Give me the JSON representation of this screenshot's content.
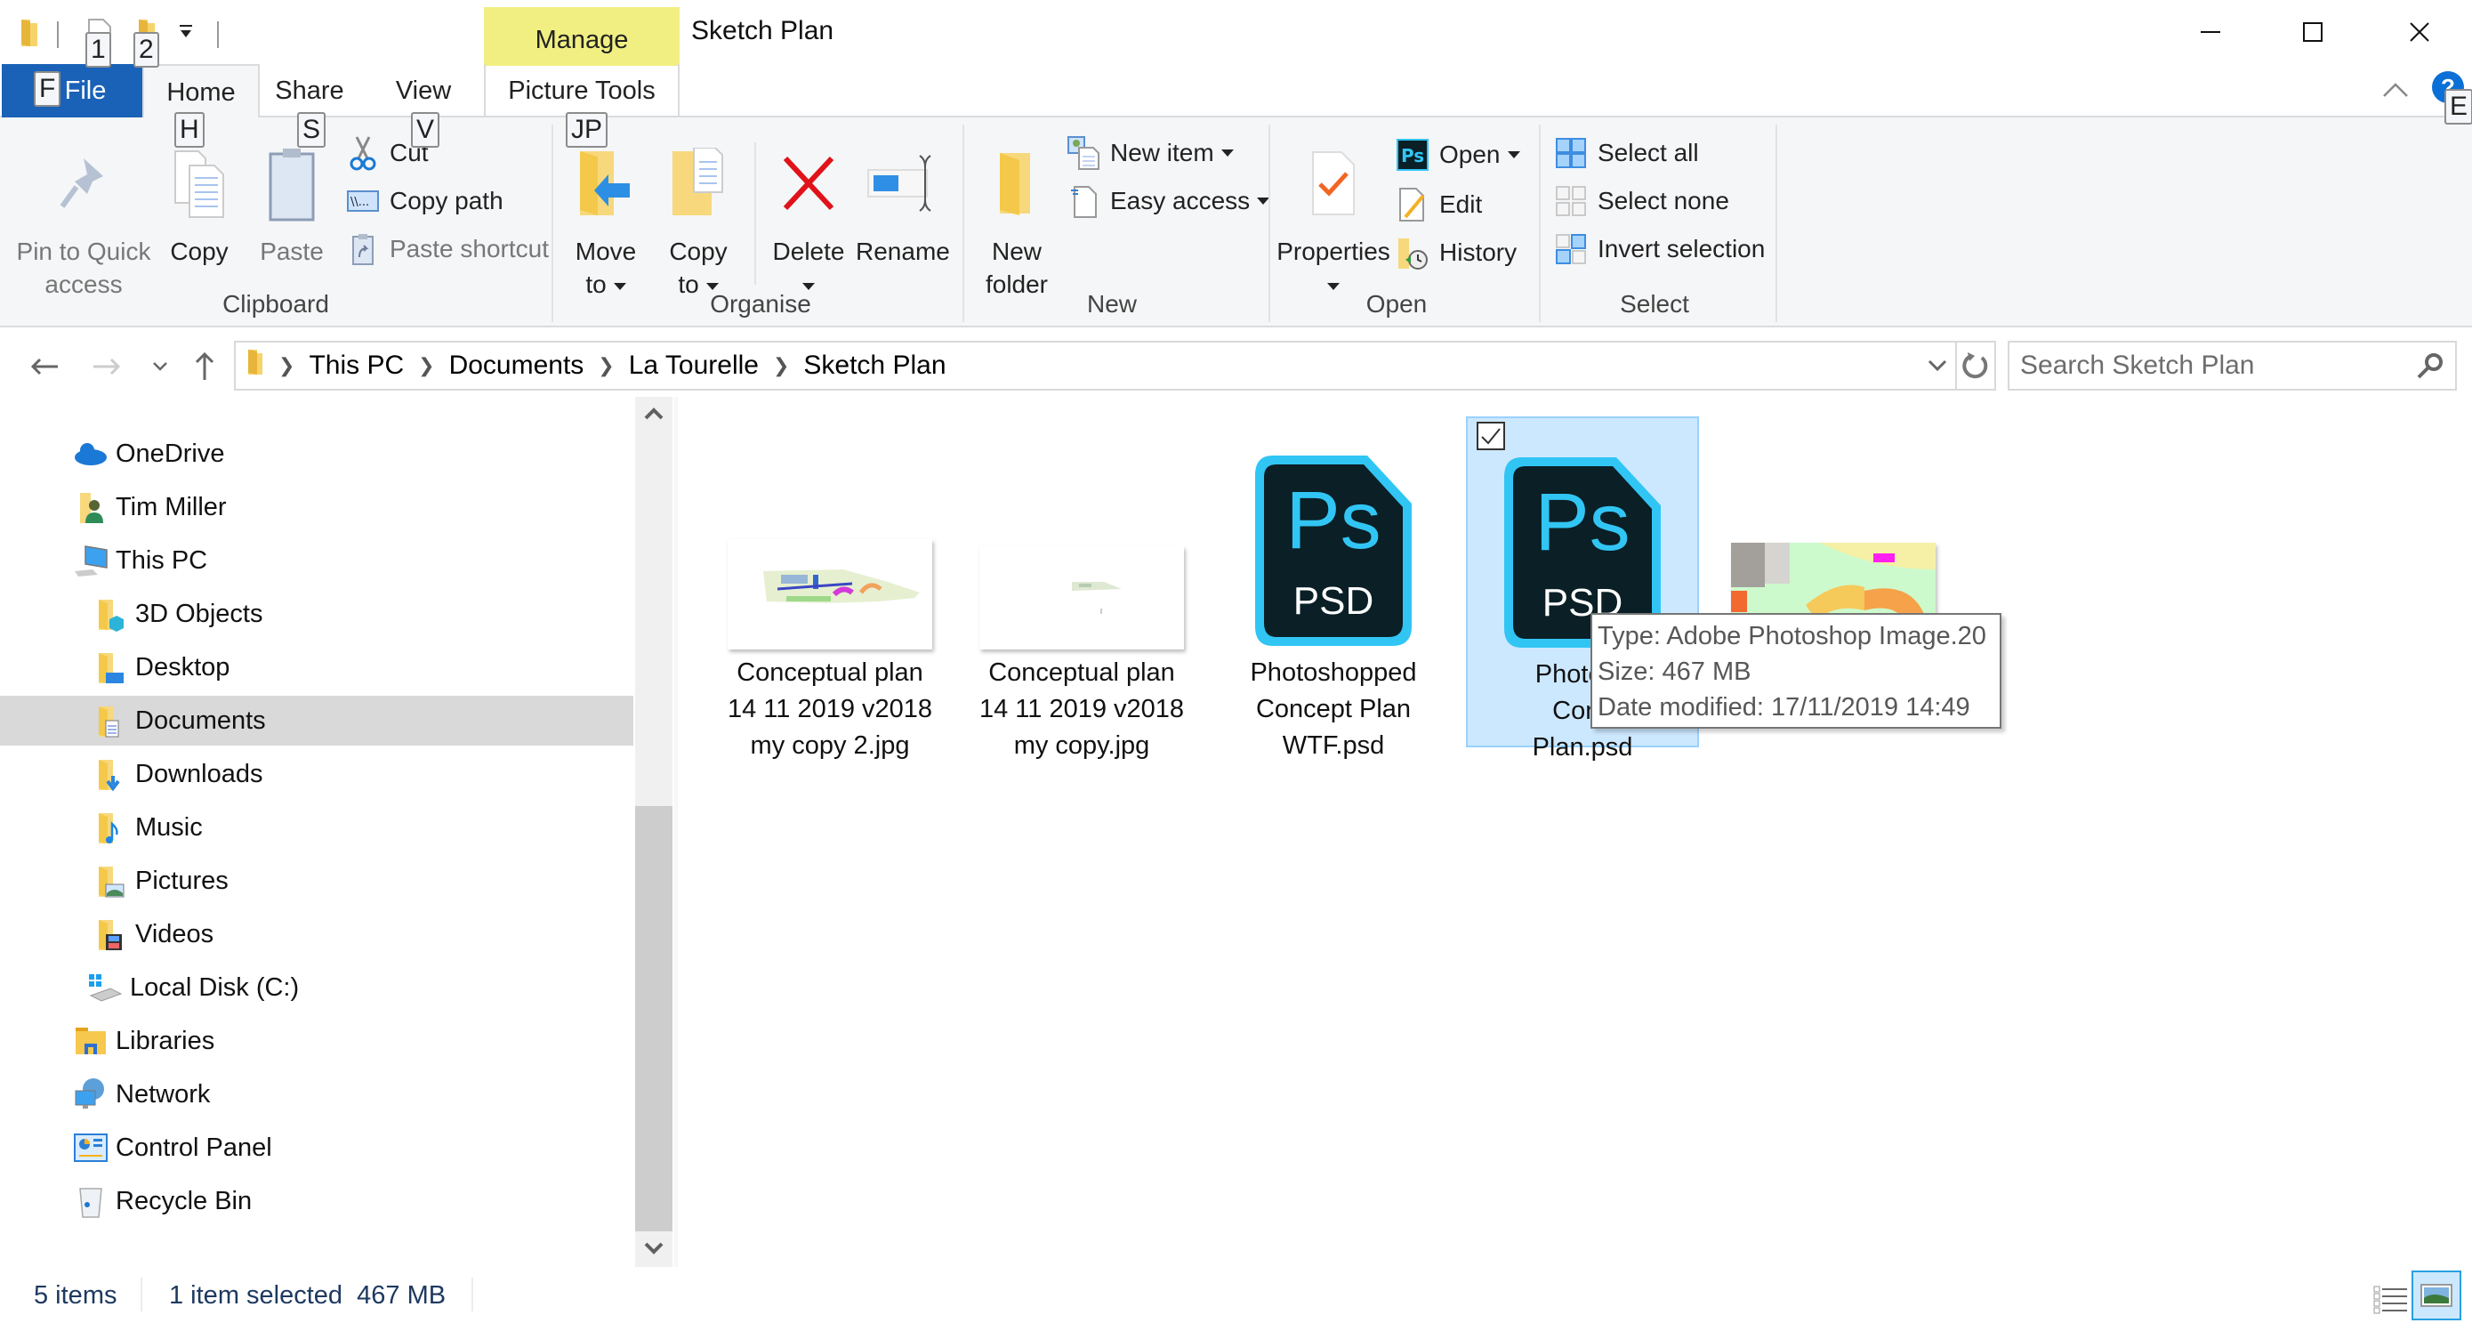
{
  "window": {
    "title": "Sketch Plan",
    "contextual_tab_group": "Manage",
    "keytips_qat": [
      "1",
      "2"
    ],
    "controls": {
      "minimize": "minimize-icon",
      "maximize": "maximize-icon",
      "close": "close-icon"
    }
  },
  "tabs": [
    {
      "label": "File",
      "keytip": "F",
      "active": false
    },
    {
      "label": "Home",
      "keytip": "H",
      "active": true
    },
    {
      "label": "Share",
      "keytip": "S",
      "active": false
    },
    {
      "label": "View",
      "keytip": "V",
      "active": false
    },
    {
      "label": "Picture Tools",
      "keytip": "JP",
      "active": false
    }
  ],
  "help_keytip": "E",
  "ribbon": {
    "clipboard": {
      "label": "Clipboard",
      "pin": "Pin to Quick access",
      "pin_line1": "Pin to Quick",
      "pin_line2": "access",
      "copy": "Copy",
      "paste": "Paste",
      "cut": "Cut",
      "copy_path": "Copy path",
      "paste_shortcut": "Paste shortcut"
    },
    "organise": {
      "label": "Organise",
      "move_to_line1": "Move",
      "move_to_line2": "to",
      "copy_to_line1": "Copy",
      "copy_to_line2": "to",
      "delete": "Delete",
      "rename": "Rename"
    },
    "new": {
      "label": "New",
      "new_folder_line1": "New",
      "new_folder_line2": "folder",
      "new_item": "New item",
      "easy_access": "Easy access"
    },
    "open": {
      "label": "Open",
      "properties": "Properties",
      "open": "Open",
      "edit": "Edit",
      "history": "History"
    },
    "select": {
      "label": "Select",
      "select_all": "Select all",
      "select_none": "Select none",
      "invert_selection": "Invert selection"
    }
  },
  "address_bar": {
    "breadcrumbs": [
      "This PC",
      "Documents",
      "La Tourelle",
      "Sketch Plan"
    ],
    "search_placeholder": "Search Sketch Plan"
  },
  "nav_pane": {
    "items": [
      {
        "label": "OneDrive",
        "icon": "onedrive-icon",
        "level": 0
      },
      {
        "label": "Tim Miller",
        "icon": "user-folder-icon",
        "level": 0
      },
      {
        "label": "This PC",
        "icon": "computer-icon",
        "level": 0
      },
      {
        "label": "3D Objects",
        "icon": "3d-objects-folder-icon",
        "level": 1
      },
      {
        "label": "Desktop",
        "icon": "desktop-folder-icon",
        "level": 1
      },
      {
        "label": "Documents",
        "icon": "documents-folder-icon",
        "level": 1,
        "selected": true
      },
      {
        "label": "Downloads",
        "icon": "downloads-folder-icon",
        "level": 1
      },
      {
        "label": "Music",
        "icon": "music-folder-icon",
        "level": 1
      },
      {
        "label": "Pictures",
        "icon": "pictures-folder-icon",
        "level": 1
      },
      {
        "label": "Videos",
        "icon": "videos-folder-icon",
        "level": 1
      },
      {
        "label": "Local Disk (C:)",
        "icon": "local-disk-icon",
        "level": 1
      },
      {
        "label": "Libraries",
        "icon": "libraries-icon",
        "level": 0
      },
      {
        "label": "Network",
        "icon": "network-icon",
        "level": 0
      },
      {
        "label": "Control Panel",
        "icon": "control-panel-icon",
        "level": 0
      },
      {
        "label": "Recycle Bin",
        "icon": "recycle-bin-icon",
        "level": 0
      }
    ]
  },
  "files": [
    {
      "name": "Conceptual plan 14 11 2019 v2018 my copy 2.jpg",
      "lines": [
        "Conceptual plan",
        "14 11 2019 v2018",
        "my copy 2.jpg"
      ],
      "type": "jpg",
      "selected": false
    },
    {
      "name": "Conceptual plan 14 11 2019 v2018 my copy.jpg",
      "lines": [
        "Conceptual plan",
        "14 11 2019 v2018",
        "my copy.jpg"
      ],
      "type": "jpg",
      "selected": false
    },
    {
      "name": "Photoshopped Concept Plan WTF.psd",
      "lines": [
        "Photoshopped",
        "Concept Plan",
        "WTF.psd"
      ],
      "type": "psd",
      "selected": false
    },
    {
      "name": "Photoshopped Concept Plan.psd",
      "lines": [
        "Photosh",
        "Conc",
        "Plan.psd"
      ],
      "type": "psd",
      "selected": true
    },
    {
      "name": "",
      "lines": [],
      "type": "jpg",
      "selected": false
    }
  ],
  "psd_icon": {
    "brand": "Ps",
    "ext": "PSD",
    "bg": "#0a1f26",
    "accent": "#31c5f4"
  },
  "tooltip": {
    "type": "Type: Adobe Photoshop Image.20",
    "size": "Size: 467 MB",
    "date_modified": "Date modified: 17/11/2019 14:49"
  },
  "status_bar": {
    "item_count": "5 items",
    "selection": "1 item selected  467 MB"
  },
  "colors": {
    "file_tab": "#1a62b7",
    "manage_tab": "#f1ef82",
    "selection_bg": "#cce8ff",
    "selection_border": "#99d1ff"
  }
}
